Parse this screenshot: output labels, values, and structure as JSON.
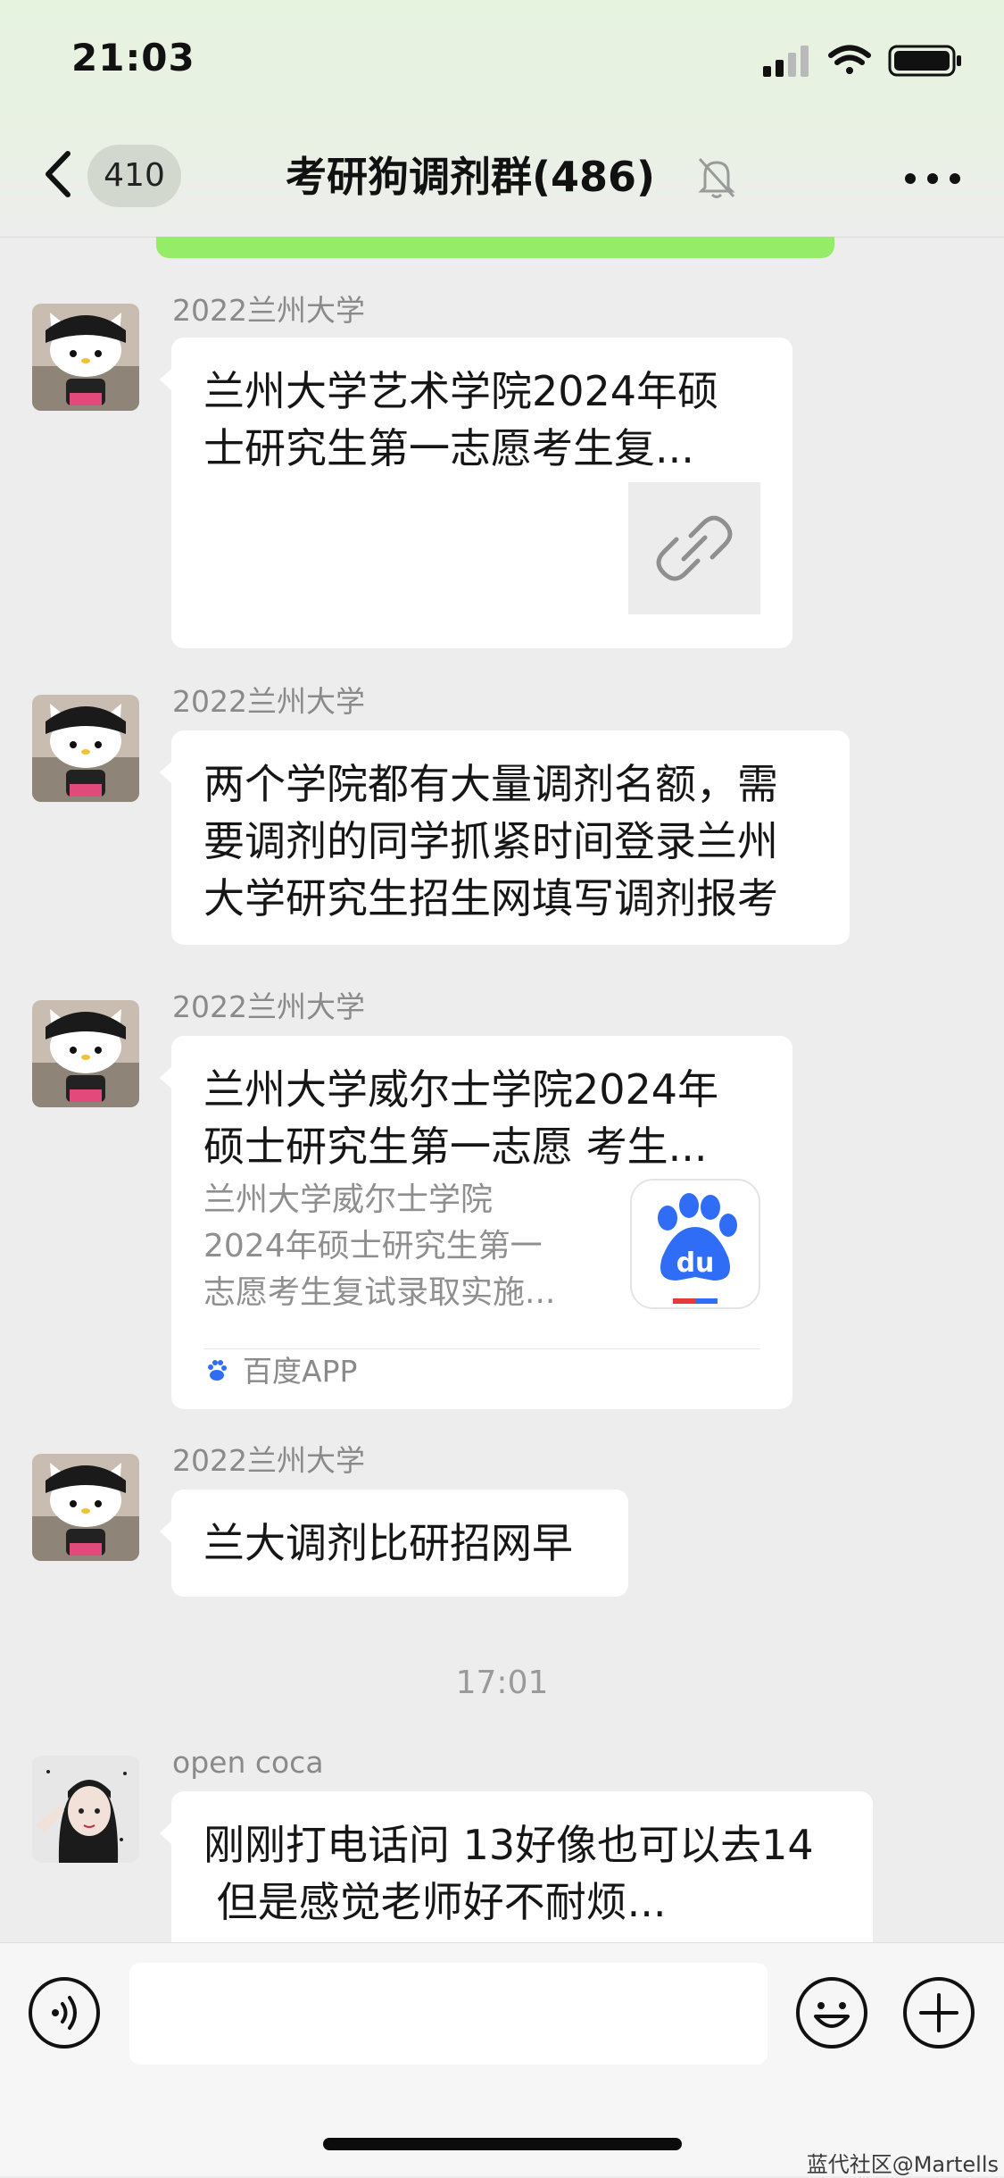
{
  "status_bar": {
    "time": "21:03",
    "icons": [
      "cellular-signal-icon",
      "wifi-icon",
      "battery-icon"
    ]
  },
  "nav": {
    "back_badge": "410",
    "title": "考研狗调剂群(486)",
    "icons": [
      "back-chevron-icon",
      "mute-bell-icon",
      "more-dots-icon"
    ]
  },
  "messages": [
    {
      "sender": "2022兰州大学",
      "type": "link",
      "title_line1": "兰州大学艺术学院2024年硕",
      "title_line2": "士研究生第一志愿考生复...",
      "icon": "link-icon"
    },
    {
      "sender": "2022兰州大学",
      "type": "text",
      "lines": [
        "两个学院都有大量调剂名额，需",
        "要调剂的同学抓紧时间登录兰州",
        "大学研究生招生网填写调剂报考"
      ]
    },
    {
      "sender": "2022兰州大学",
      "type": "app_card",
      "title_line1": "兰州大学威尔士学院2024年",
      "title_line2": "硕士研究生第一志愿 考生...",
      "desc_lines": [
        "兰州大学威尔士学院",
        "2024年硕士研究生第一",
        "志愿考生复试录取实施..."
      ],
      "source": "百度APP",
      "thumb_text": "du"
    },
    {
      "sender": "2022兰州大学",
      "type": "text",
      "lines": [
        "兰大调剂比研招网早"
      ]
    },
    {
      "type": "time",
      "text": "17:01"
    },
    {
      "sender": "open coca",
      "type": "text",
      "lines": [
        "刚刚打电话问 13好像也可以去14",
        " 但是感觉老师好不耐烦..."
      ]
    }
  ],
  "input_bar": {
    "value": "",
    "icons": [
      "voice-icon",
      "emoji-icon",
      "plus-icon"
    ]
  },
  "watermark": "蓝代社区@Martells",
  "colors": {
    "background": "#ededed",
    "bubble": "#ffffff",
    "accent_green": "#95ec69",
    "baidu_blue": "#2f6df6"
  }
}
